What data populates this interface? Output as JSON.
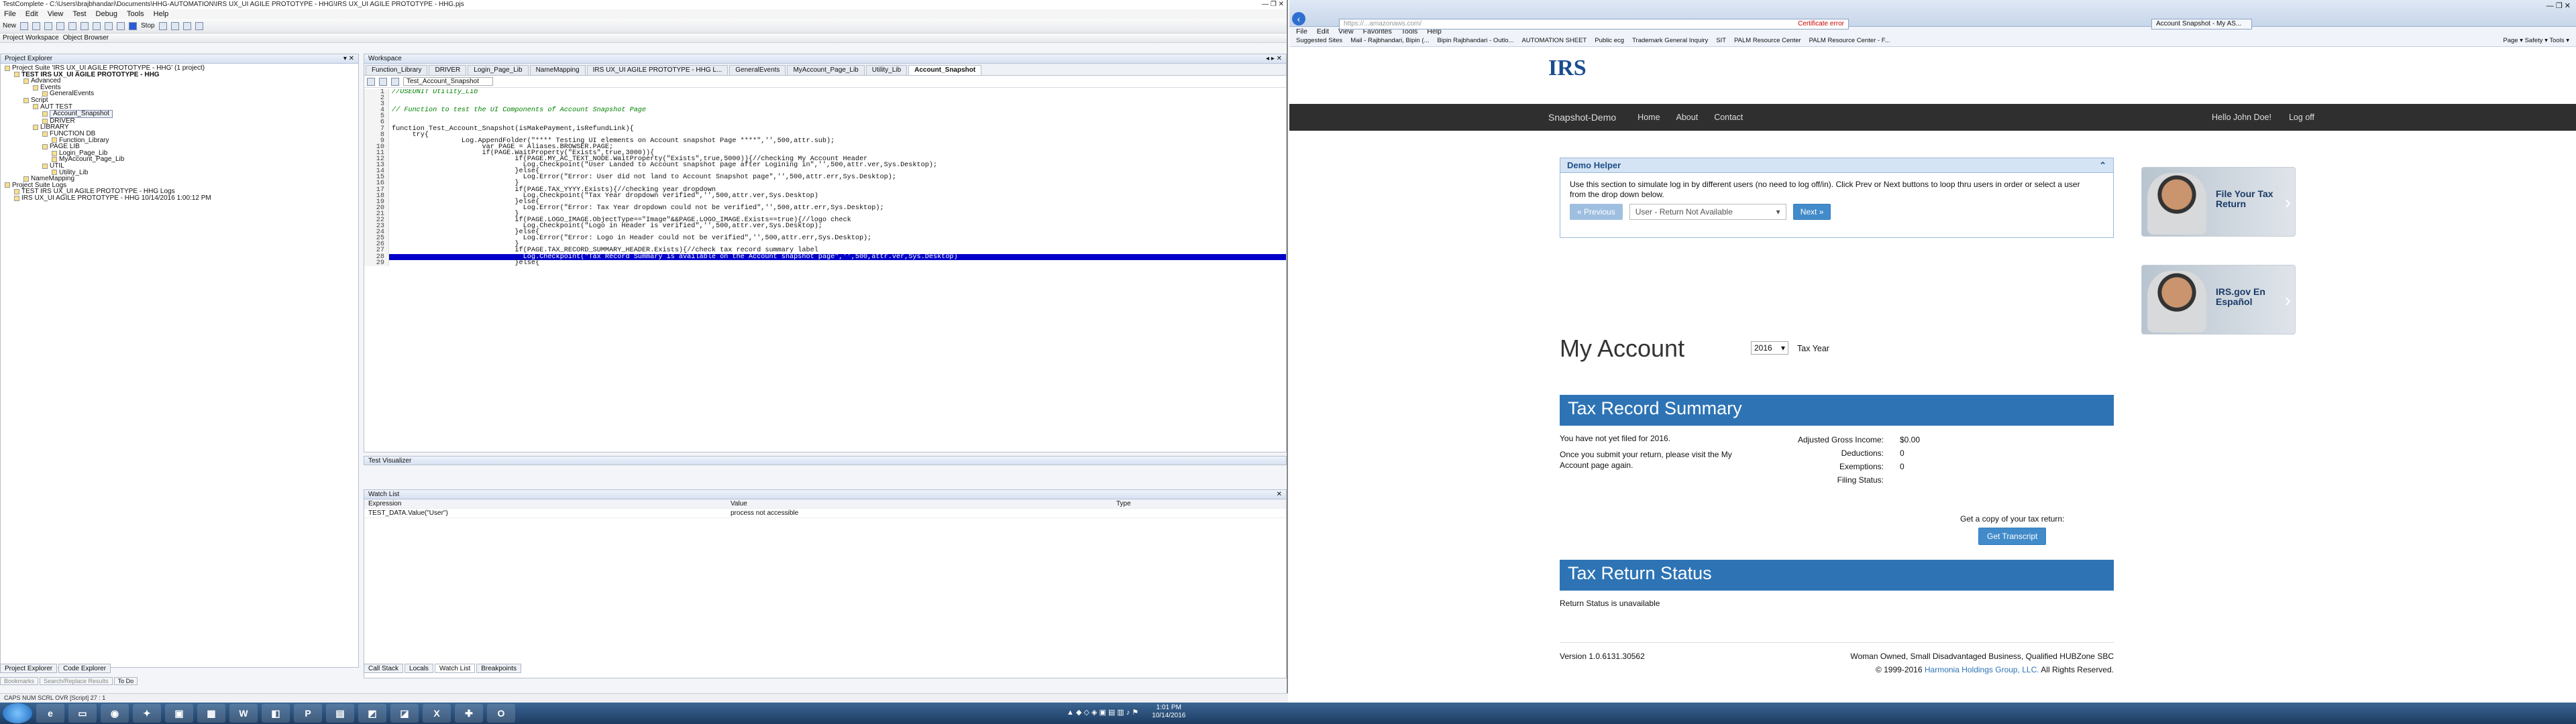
{
  "tc": {
    "title": "TestComplete - C:\\Users\\brajbhandari\\Documents\\HHG-AUTOMATION\\IRS UX_UI AGILE PROTOTYPE - HHG\\IRS UX_UI AGILE PROTOTYPE - HHG.pjs",
    "menu": [
      "File",
      "Edit",
      "View",
      "Test",
      "Debug",
      "Tools",
      "Help"
    ],
    "toolbar_new": "New",
    "toolbar_stop": "Stop",
    "pe_title": "Project Explorer",
    "workspace_title": "Workspace",
    "left_tabs": [
      "Project Workspace",
      "Object Browser"
    ],
    "tree": [
      {
        "t": "Project Suite 'IRS UX_UI AGILE PROTOTYPE - HHG' (1 project)",
        "d": 0
      },
      {
        "t": "TEST IRS UX_UI AGILE PROTOTYPE - HHG",
        "d": 1,
        "b": true
      },
      {
        "t": "Advanced",
        "d": 2
      },
      {
        "t": "Events",
        "d": 3
      },
      {
        "t": "GeneralEvents",
        "d": 4
      },
      {
        "t": "Script",
        "d": 2
      },
      {
        "t": "AUT TEST",
        "d": 3
      },
      {
        "t": "Account_Snapshot",
        "d": 4,
        "sel": true
      },
      {
        "t": "DRIVER",
        "d": 4
      },
      {
        "t": "LIBRARY",
        "d": 3
      },
      {
        "t": "FUNCTION DB",
        "d": 4
      },
      {
        "t": "Function_Library",
        "d": 5
      },
      {
        "t": "PAGE LIB",
        "d": 4
      },
      {
        "t": "Login_Page_Lib",
        "d": 5
      },
      {
        "t": "MyAccount_Page_Lib",
        "d": 5
      },
      {
        "t": "UTIL",
        "d": 4
      },
      {
        "t": "Utility_Lib",
        "d": 5
      },
      {
        "t": "NameMapping",
        "d": 2
      },
      {
        "t": "Project Suite Logs",
        "d": 0
      },
      {
        "t": "TEST IRS UX_UI AGILE PROTOTYPE - HHG Logs",
        "d": 1
      },
      {
        "t": "IRS UX_UI AGILE PROTOTYPE - HHG 10/14/2016 1:00:12 PM",
        "d": 1
      }
    ],
    "doc_tabs": [
      "Function_Library",
      "DRIVER",
      "Login_Page_Lib",
      "NameMapping",
      "IRS UX_UI AGILE PROTOTYPE - HHG L...",
      "GeneralEvents",
      "MyAccount_Page_Lib",
      "Utility_Lib",
      "Account_Snapshot"
    ],
    "editor_title": "Test_Account_Snapshot",
    "code": [
      {
        "n": "1",
        "t": "//USEUNIT Utility_Lib",
        "c": true
      },
      {
        "n": "2",
        "t": ""
      },
      {
        "n": "3",
        "t": ""
      },
      {
        "n": "4",
        "t": "// Function to test the UI Components of Account Snapshot Page",
        "c": true
      },
      {
        "n": "5",
        "t": ""
      },
      {
        "n": "6",
        "t": ""
      },
      {
        "n": "7",
        "t": "function Test_Account_Snapshot(isMakePayment,isRefundLink){"
      },
      {
        "n": "8",
        "t": "     try{"
      },
      {
        "n": "9",
        "t": "                 Log.AppendFolder(\"**** Testing UI elements on Account snapshot Page ****\",'',500,attr.sub);"
      },
      {
        "n": "10",
        "t": "                      var PAGE = Aliases.BROWSER.PAGE;"
      },
      {
        "n": "11",
        "t": "                      if(PAGE.WaitProperty(\"Exists\",true,3000)){"
      },
      {
        "n": "12",
        "t": "                              if(PAGE.MY_AC_TEXT_NODE.WaitProperty(\"Exists\",true,5000)){//checking My Account Header"
      },
      {
        "n": "13",
        "t": "                                Log.Checkpoint(\"User Landed to Account snapshot page after Logining in\",'',500,attr.ver,Sys.Desktop);"
      },
      {
        "n": "14",
        "t": "                              }else{"
      },
      {
        "n": "15",
        "t": "                                Log.Error(\"Error: User did not land to Account Snapshot page\",'',500,attr.err,Sys.Desktop);"
      },
      {
        "n": "16",
        "t": "                              }"
      },
      {
        "n": "17",
        "t": "                              if(PAGE.TAX_YYYY.Exists){//checking year dropdown"
      },
      {
        "n": "18",
        "t": "                                Log.Checkpoint(\"Tax Year dropdown verified\",'',500,attr.ver,Sys.Desktop)"
      },
      {
        "n": "19",
        "t": "                              }else{"
      },
      {
        "n": "20",
        "t": "                                Log.Error(\"Error: Tax Year dropdown could not be verified\",'',500,attr.err,Sys.Desktop);"
      },
      {
        "n": "21",
        "t": "                              }"
      },
      {
        "n": "22",
        "t": "                              if(PAGE.LOGO_IMAGE.ObjectType==\"Image\"&&PAGE.LOGO_IMAGE.Exists==true){//logo check"
      },
      {
        "n": "23",
        "t": "                                Log.Checkpoint(\"Logo in Header is verified\",'',500,attr.ver,Sys.Desktop);"
      },
      {
        "n": "24",
        "t": "                              }else{"
      },
      {
        "n": "25",
        "t": "                                Log.Error(\"Error: Logo in Header could not be verified\",'',500,attr.err,Sys.Desktop);"
      },
      {
        "n": "26",
        "t": "                              }"
      },
      {
        "n": "27",
        "t": "                              if(PAGE.TAX_RECORD_SUMMARY_HEADER.Exists){//check tax record summary label"
      },
      {
        "n": "28",
        "t": "                                Log.Checkpoint(\"Tax Record Summary is available on the Account snapshot page\",'',500,attr.ver,Sys.Desktop)",
        "hl": true
      },
      {
        "n": "29",
        "t": "                              }else{"
      }
    ],
    "test_visualizer": "Test Visualizer",
    "watch": {
      "title": "Watch List",
      "cols": [
        "Expression",
        "Value",
        "Type"
      ],
      "row": [
        "TEST_DATA.Value(\"User\")",
        "process not accessible",
        ""
      ]
    },
    "bottom_tabs": [
      "Call Stack",
      "Locals",
      "Watch List",
      "Breakpoints"
    ],
    "pe_bottom_tabs": [
      "Project Explorer",
      "Code Explorer"
    ],
    "status_tabs": [
      "Bookmarks",
      "Search/Replace Results",
      "To Do"
    ],
    "status": "CAPS  NUM  SCRL  OVR   [Script]   27 : 1"
  },
  "ie": {
    "address": "https://...amazonaws.com/",
    "cert": "Certificate error",
    "tab": "Account Snapshot - My AS...",
    "menu": [
      "File",
      "Edit",
      "View",
      "Favorites",
      "Tools",
      "Help"
    ],
    "favorites": [
      "Suggested Sites",
      "Mail - Rajbhandari, Bipin (...",
      "Bipin Rajbhandari - Outlo...",
      "AUTOMATION SHEET",
      "Public ecg",
      "Trademark General Inquiry",
      "SIT",
      "PALM Resource Center",
      "PALM Resource Center - F..."
    ],
    "fav_tools": "Page ▾  Safety ▾  Tools ▾"
  },
  "site": {
    "logo": "IRS",
    "nav": {
      "brand": "Snapshot-Demo",
      "links": [
        "Home",
        "About",
        "Contact"
      ],
      "user": "Hello John Doe!",
      "logout": "Log off"
    },
    "demo": {
      "title": "Demo Helper",
      "text": "Use this section to simulate log in by different users (no need to log off/in). Click Prev or Next buttons to loop thru users in order or select a user from the drop down below.",
      "prev": "Previous",
      "select": "User - Return Not Available",
      "next": "Next"
    },
    "promo1": "File Your Tax Return",
    "promo2": "IRS.gov En Español",
    "my_account": "My Account",
    "year": "2016",
    "year_label": "Tax Year",
    "trs_title": "Tax Record Summary",
    "not_filed": "You have not yet filed for 2016.",
    "submit_note": "Once you submit your return, please visit the My Account page again.",
    "fields": [
      {
        "k": "Adjusted Gross Income:",
        "v": "$0.00"
      },
      {
        "k": "Deductions:",
        "v": "0"
      },
      {
        "k": "Exemptions:",
        "v": "0"
      },
      {
        "k": "Filing Status:",
        "v": ""
      }
    ],
    "transcript_text": "Get a copy of your tax return:",
    "transcript_btn": "Get Transcript",
    "trst_title": "Tax Return Status",
    "return_status": "Return Status is unavailable",
    "version": "Version 1.0.6131.30562",
    "footer1": "Woman Owned, Small Disadvantaged Business, Qualified HUBZone SBC",
    "footer2a": "© 1999-2016 ",
    "footer2link": "Harmonia Holdings Group, LLC.",
    "footer2b": " All Rights Reserved."
  },
  "taskbar": {
    "time": "1:01 PM",
    "date": "10/14/2016"
  }
}
